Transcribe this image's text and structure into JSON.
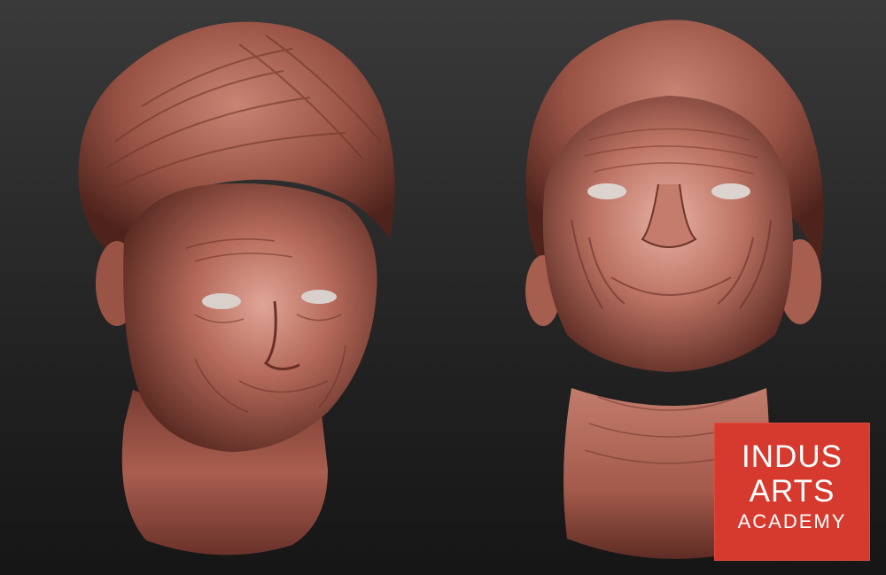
{
  "scene": {
    "background_top": "#3a3a3a",
    "background_bottom": "#161616",
    "clay_color": "#b56a5a",
    "clay_highlight": "#e0a596",
    "clay_shadow": "#5a2a22"
  },
  "logo": {
    "line1": "INDUS",
    "line2": "ARTS",
    "line3": "ACADEMY",
    "background": "#d63a2e",
    "text_color": "#ffffff"
  }
}
